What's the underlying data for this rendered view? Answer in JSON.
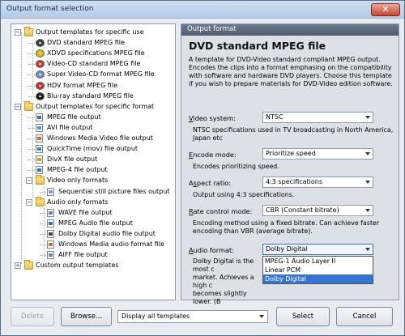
{
  "window": {
    "title": "Output format selection",
    "close_label": "✕"
  },
  "tree": {
    "items": [
      {
        "label": "Output templates for specific use",
        "icon": "folder-icon",
        "level": 0,
        "expanded": true
      },
      {
        "label": "DVD standard MPEG file",
        "icon": "dvd-disc-icon",
        "level": 1,
        "color": "#3a3a3a"
      },
      {
        "label": "XDVD specifications MPEG file",
        "icon": "xdvd-disc-icon",
        "level": 1,
        "color": "#d9b800"
      },
      {
        "label": "Video-CD standard MPEG file",
        "icon": "vcd-disc-icon",
        "level": 1,
        "color": "#c83c3c"
      },
      {
        "label": "Super Video-CD format MPEG file",
        "icon": "svcd-disc-icon",
        "level": 1,
        "color": "#6a8fd2"
      },
      {
        "label": "HDV format MPEG file",
        "icon": "hdv-disc-icon",
        "level": 1,
        "color": "#cc3030"
      },
      {
        "label": "Blu-ray standard MPEG file",
        "icon": "bluray-disc-icon",
        "level": 1,
        "color": "#1c1c1c"
      },
      {
        "label": "Output templates for specific format",
        "icon": "folder-icon",
        "level": 0,
        "expanded": true
      },
      {
        "label": "MPEG file output",
        "icon": "mpeg-file-icon",
        "level": 1,
        "color": "#3a70c8"
      },
      {
        "label": "AVI file output",
        "icon": "avi-file-icon",
        "level": 1,
        "color": "#6c8ec8"
      },
      {
        "label": "Windows Media Video file output",
        "icon": "wmv-file-icon",
        "level": 1,
        "color": "#d46a2a"
      },
      {
        "label": "QuickTime (mov) file output",
        "icon": "quicktime-file-icon",
        "level": 1,
        "color": "#3a86d4"
      },
      {
        "label": "DivX file output",
        "icon": "divx-file-icon",
        "level": 1,
        "color": "#c8a020"
      },
      {
        "label": "MPEG-4 file output",
        "icon": "mpeg4-file-icon",
        "level": 1,
        "color": "#3a70c8"
      },
      {
        "label": "Video only formats",
        "icon": "folder-icon",
        "level": 1,
        "expanded": true
      },
      {
        "label": "Sequential still picture files output",
        "icon": "still-picture-icon",
        "level": 2,
        "color": "#7aa0d0"
      },
      {
        "label": "Audio only formats",
        "icon": "folder-icon",
        "level": 1,
        "expanded": true
      },
      {
        "label": "WAVE file output",
        "icon": "wave-file-icon",
        "level": 2,
        "color": "#5a86c8"
      },
      {
        "label": "MPEG Audio file output",
        "icon": "mpeg-audio-file-icon",
        "level": 2,
        "color": "#3a70c8"
      },
      {
        "label": "Dolby Digital audio file output",
        "icon": "dolby-file-icon",
        "level": 2,
        "color": "#444444"
      },
      {
        "label": "Windows Media audio format file",
        "icon": "wma-file-icon",
        "level": 2,
        "color": "#d46a2a"
      },
      {
        "label": "AIFF file output",
        "icon": "aiff-file-icon",
        "level": 2,
        "color": "#7a8896"
      },
      {
        "label": "Custom output templates",
        "icon": "folder-icon",
        "level": 0,
        "expanded": false
      }
    ]
  },
  "panel": {
    "header": "Output format",
    "title": "DVD standard MPEG file",
    "description": "A template for DVD-Video standard compliant MPEG output. Encodes the clips into a format emphasing on the compatibility with software and hardware DVD players. Choose this template if you wish to prepare materials for DVD-Video edition software.",
    "fields": {
      "video_system": {
        "label": "Video system:",
        "value": "NTSC",
        "note": "NTSC specifications used in TV broadcasting in North America, Japan etc"
      },
      "encode_mode": {
        "label": "Encode mode:",
        "value": "Prioritize speed",
        "note": "Encodes prioritizing speed."
      },
      "aspect_ratio": {
        "label": "Aspect ratio:",
        "value": "4:3 specifications",
        "note": "Output using 4:3 specifications."
      },
      "rate_control": {
        "label": "Rate control mode:",
        "value": "CBR (Constant bitrate)",
        "note": "Encoding method using a fixed bitrate. Can achieve faster encoding than VBR (average bitrate)."
      },
      "audio_format": {
        "label": "Audio format:",
        "value": "Dolby Digital",
        "note_visible": [
          "Dolby Digital is the most c",
          "market. Achieves a high c",
          "becomes slightly lower. (B"
        ],
        "options": [
          "MPEG-1 Audio Layer II",
          "Linear PCM",
          "Dolby Digital"
        ],
        "selected_option": "Dolby Digital"
      }
    }
  },
  "footer": {
    "delete_label": "Delete",
    "browse_label": "Browse...",
    "filter_value": "Display all templates",
    "select_label": "Select",
    "cancel_label": "Cancel"
  },
  "colors": {
    "titlebar": "#c3d6ee",
    "panel_header": "#5d6a7b",
    "selection": "#3375d7"
  }
}
